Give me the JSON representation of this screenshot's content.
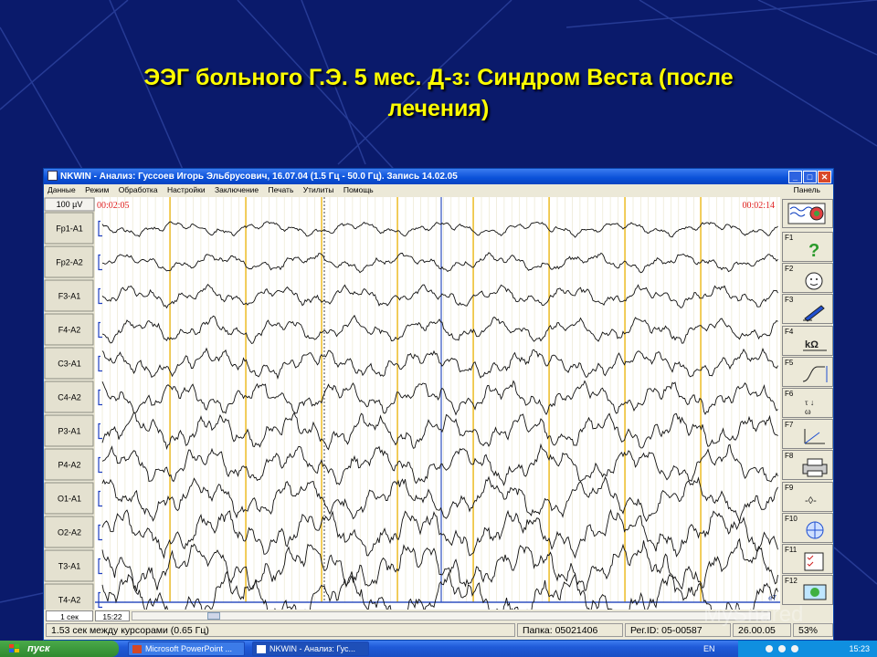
{
  "slide": {
    "title_line1": "ЭЭГ больного Г.Э. 5 мес. Д-з: Синдром Веста (после",
    "title_line2": "лечения)"
  },
  "window": {
    "title": "NKWIN - Анализ: Гуссоев Игорь Эльбрусович, 16.07.04 (1.5 Гц - 50.0 Гц). Запись 14.02.05",
    "minimize_glyph": "_",
    "maximize_glyph": "□",
    "close_glyph": "✕"
  },
  "menu": {
    "items": [
      "Данные",
      "Режим",
      "Обработка",
      "Настройки",
      "Заключение",
      "Печать",
      "Утилиты",
      "Помощь"
    ],
    "panel_label": "Панель"
  },
  "eeg": {
    "scale_label": "100 µV",
    "time_left": "00:02:05",
    "time_right": "00:02:14",
    "channels": [
      "Fp1-A1",
      "Fp2-A2",
      "F3-A1",
      "F4-A2",
      "C3-A1",
      "C4-A2",
      "P3-A1",
      "P4-A2",
      "O1-A1",
      "O2-A2",
      "T3-A1",
      "T4-A2"
    ],
    "corner_mark": "e7"
  },
  "side_panel": {
    "keys": [
      {
        "label": "F1",
        "icon": "help-icon"
      },
      {
        "label": "F2",
        "icon": "face-icon"
      },
      {
        "label": "F3",
        "icon": "pen-icon"
      },
      {
        "label": "F4",
        "icon": "impedance-icon"
      },
      {
        "label": "F5",
        "icon": "calibration-icon"
      },
      {
        "label": "F6",
        "icon": "time-constant-icon"
      },
      {
        "label": "F7",
        "icon": "axis-icon"
      },
      {
        "label": "F8",
        "icon": "printer-icon"
      },
      {
        "label": "F9",
        "icon": "marker-icon"
      },
      {
        "label": "F10",
        "icon": "globe-icon"
      },
      {
        "label": "F11",
        "icon": "checklist-icon"
      },
      {
        "label": "F12",
        "icon": "map-icon"
      }
    ]
  },
  "bottom": {
    "time_scale": "1 сек",
    "time_position": "15:22"
  },
  "status": {
    "cursor_info": "1.53 сек между курсорами (0.65 Гц)",
    "folder": "Папка: 05021406",
    "reg_id": "Рег.ID: 05-00587",
    "date": "26.00.05",
    "percent": "53%"
  },
  "taskbar": {
    "start_label": "пуск",
    "tasks": [
      "Microsoft PowerPoint ...",
      "NKWIN - Анализ: Гус..."
    ],
    "lang": "EN",
    "clock": "15:23"
  },
  "watermark": "MyShared",
  "colors": {
    "slide_bg": "#0a1a6b",
    "title_yellow": "#ffff00",
    "marker_orange": "#f0b400",
    "cursor_blue": "#3050c0",
    "time_red": "#e02020"
  }
}
